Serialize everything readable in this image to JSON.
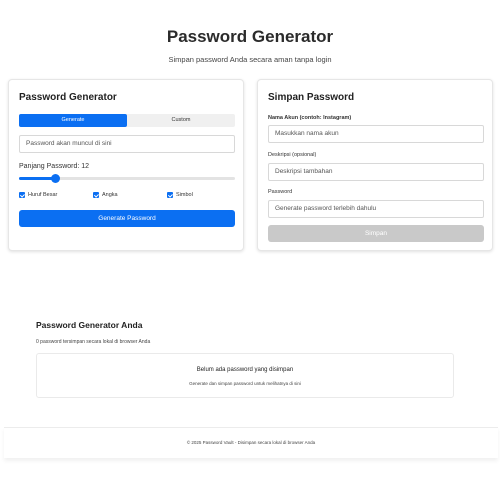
{
  "header": {
    "title": "Password Generator",
    "subtitle": "Simpan password Anda secara aman tanpa login"
  },
  "generator": {
    "title": "Password Generator",
    "tabs": [
      {
        "label": "Generate",
        "active": true
      },
      {
        "label": "Custom",
        "active": false
      }
    ],
    "output_placeholder": "Password akan muncul di sini",
    "length_label": "Panjang Password: 12",
    "length_fraction": 0.17,
    "options": [
      {
        "label": "Huruf Besar",
        "checked": true
      },
      {
        "label": "Angka",
        "checked": true
      },
      {
        "label": "Simbol",
        "checked": true
      }
    ],
    "generate_label": "Generate Password"
  },
  "save": {
    "title": "Simpan Password",
    "account_label": "Nama Akun (contoh: Instagram)",
    "account_placeholder": "Masukkan nama akun",
    "description_label": "Deskripsi (opsional)",
    "description_placeholder": "Deskripsi tambahan",
    "password_label": "Password",
    "password_placeholder": "Generate password terlebih dahulu",
    "save_label": "Simpan"
  },
  "saved": {
    "title": "Password Generator Anda",
    "count_text": "0 password tersimpan secara lokal di browser Anda",
    "empty_title": "Belum ada password yang disimpan",
    "empty_hint": "Generate dan simpan password untuk melihatnya di sini"
  },
  "footer": {
    "text": "© 2025 Password Vault - Disimpan secara lokal di browser Anda"
  },
  "colors": {
    "accent": "#0b6ff2",
    "disabled": "#c9c9c9"
  }
}
